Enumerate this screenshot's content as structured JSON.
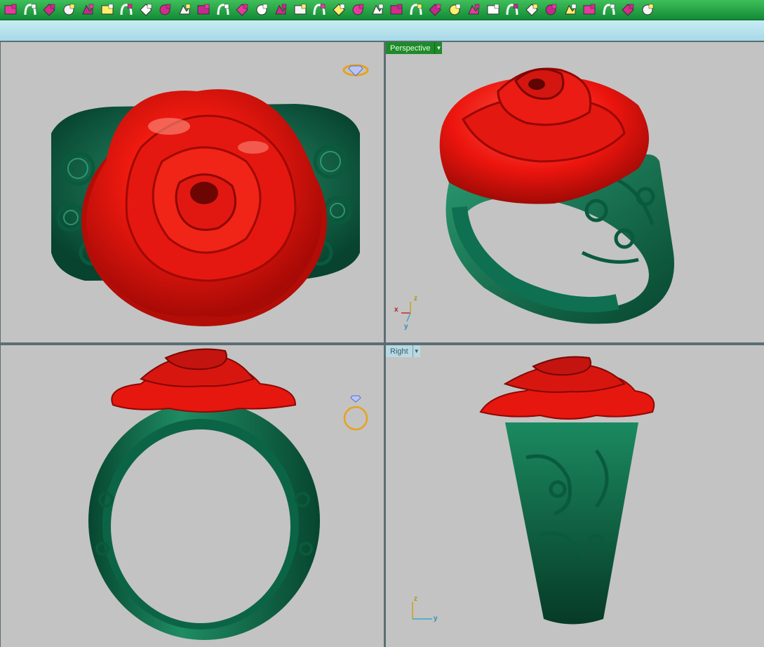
{
  "toolbar": {
    "buttons": [
      {
        "icon": "curve-network-icon"
      },
      {
        "icon": "arch-ring-icon"
      },
      {
        "icon": "bend-tool-icon"
      },
      {
        "icon": "sweep-profile-icon"
      },
      {
        "icon": "box-profile-icon"
      },
      {
        "icon": "shank-profile-icon"
      },
      {
        "icon": "gem-cut-icon"
      },
      {
        "icon": "twist-tool-icon"
      },
      {
        "icon": "prong-head-icon"
      },
      {
        "icon": "frame-profile-icon"
      },
      {
        "icon": "grid-pattern-icon"
      },
      {
        "icon": "box-array-icon"
      },
      {
        "icon": "cluster-grid-icon"
      },
      {
        "icon": "paint-stroke-icon"
      },
      {
        "icon": "paint-fill-icon"
      },
      {
        "icon": "hoop-tool-icon"
      },
      {
        "icon": "chair-profile-icon"
      },
      {
        "icon": "layered-ring-icon"
      },
      {
        "icon": "dot-grid-icon"
      },
      {
        "icon": "curve-arc-icon"
      },
      {
        "icon": "hand-pick-icon"
      },
      {
        "icon": "point-scatter-icon"
      },
      {
        "icon": "star-node-icon"
      },
      {
        "icon": "diamond-flip-icon"
      },
      {
        "icon": "node-cross-icon"
      },
      {
        "icon": "star-route-icon"
      },
      {
        "icon": "pentagon-gem-icon"
      },
      {
        "icon": "triple-arrow-icon"
      },
      {
        "icon": "stack-sheet-icon"
      },
      {
        "icon": "tilted-plane-icon"
      },
      {
        "icon": "grid-plane-icon"
      },
      {
        "icon": "scissor-cut-icon"
      },
      {
        "icon": "box-shade-icon"
      },
      {
        "icon": "gear-icon"
      }
    ]
  },
  "viewports": {
    "top_left": {
      "label": ""
    },
    "top_right": {
      "label": "Perspective"
    },
    "bottom_left": {
      "label": ""
    },
    "bottom_right": {
      "label": "Right"
    }
  },
  "axes": {
    "perspective": {
      "x": "x",
      "y": "y",
      "z": "z"
    },
    "right": {
      "y": "y",
      "z": "z"
    }
  },
  "colors": {
    "rose": "#e8140f",
    "band": "#0f6e4e",
    "viewport_bg": "#c3c3c3",
    "active_tab": "#1f8a2a"
  }
}
